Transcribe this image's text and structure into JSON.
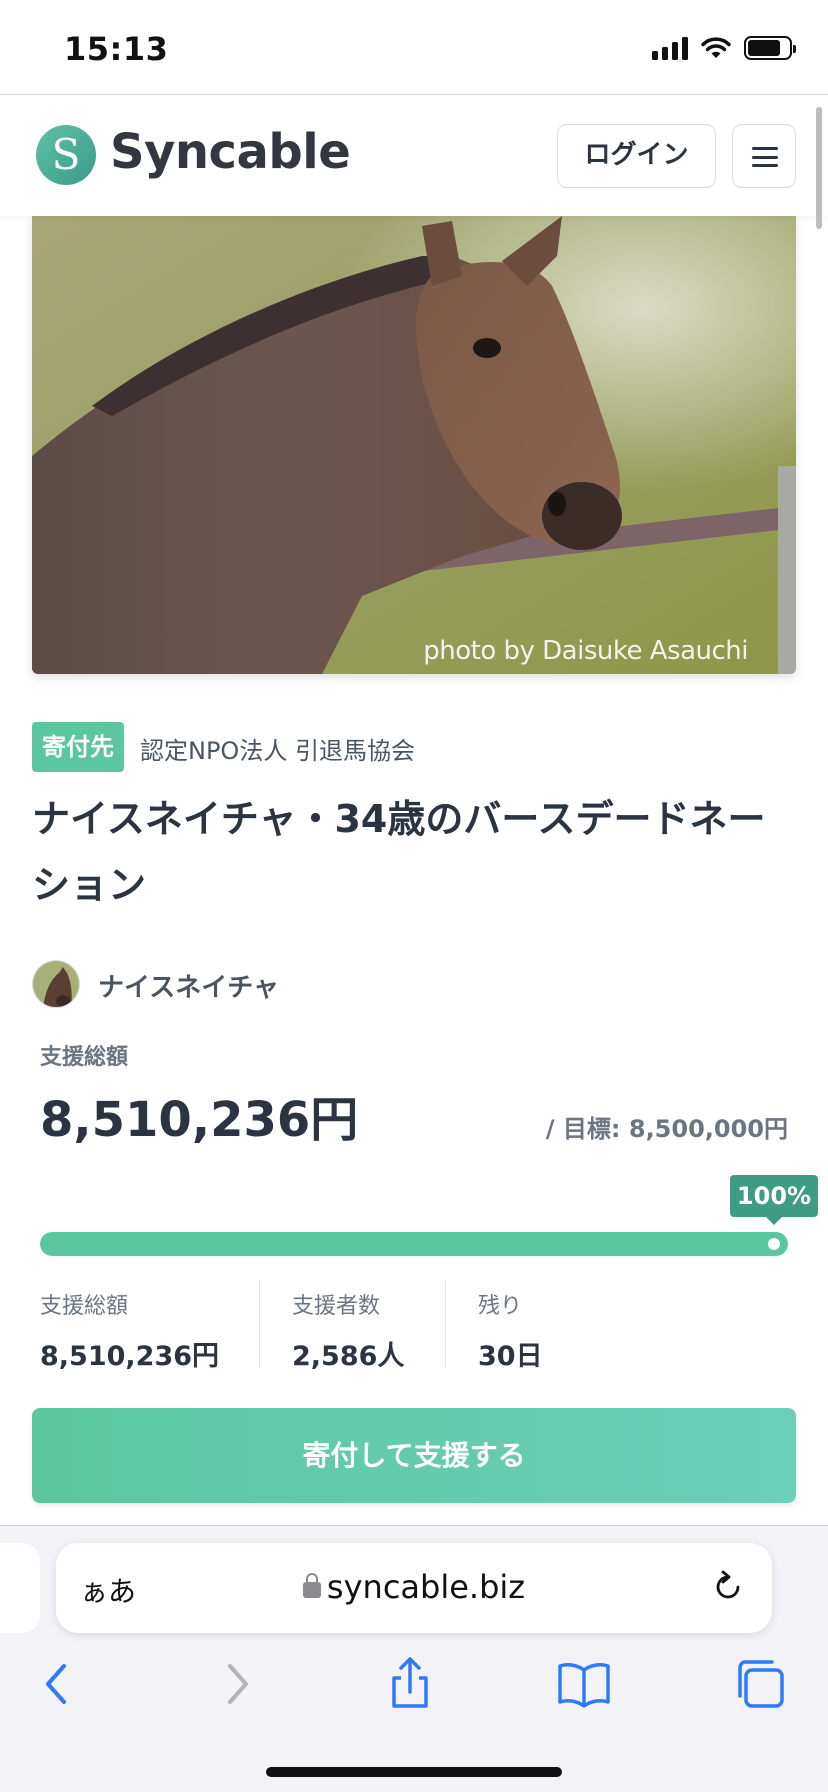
{
  "status_bar": {
    "time": "15:13"
  },
  "header": {
    "logo_letter": "S",
    "logo_text": "Syncable",
    "login_label": "ログイン",
    "icons": [
      "menu-icon"
    ]
  },
  "hero": {
    "photo_credit": "photo by Daisuke Asauchi"
  },
  "project": {
    "badge": "寄付先",
    "org_name": "認定NPO法人 引退馬協会",
    "title": "ナイスネイチャ・34歳のバースデードネーション",
    "avatar_name": "ナイスネイチャ"
  },
  "funding": {
    "total_label": "支援総額",
    "total_amount": "8,510,236円",
    "goal": "/ 目標: 8,500,000円",
    "percent_label": "100%",
    "progress_fraction": 1.0,
    "stats": [
      {
        "label": "支援総額",
        "value": "8,510,236円"
      },
      {
        "label": "支援者数",
        "value": "2,586人"
      },
      {
        "label": "残り",
        "value": "30日"
      }
    ]
  },
  "cta": {
    "label": "寄付して支援する"
  },
  "browser": {
    "aa_label": "ぁあ",
    "url": "syncable.biz",
    "icons": [
      "lock-icon",
      "reload-icon",
      "back-icon",
      "forward-icon",
      "share-icon",
      "bookmarks-icon",
      "tabs-icon"
    ]
  },
  "colors": {
    "accent": "#5cc6a0",
    "accent_dark": "#3f9c84",
    "text": "#2b3440"
  }
}
